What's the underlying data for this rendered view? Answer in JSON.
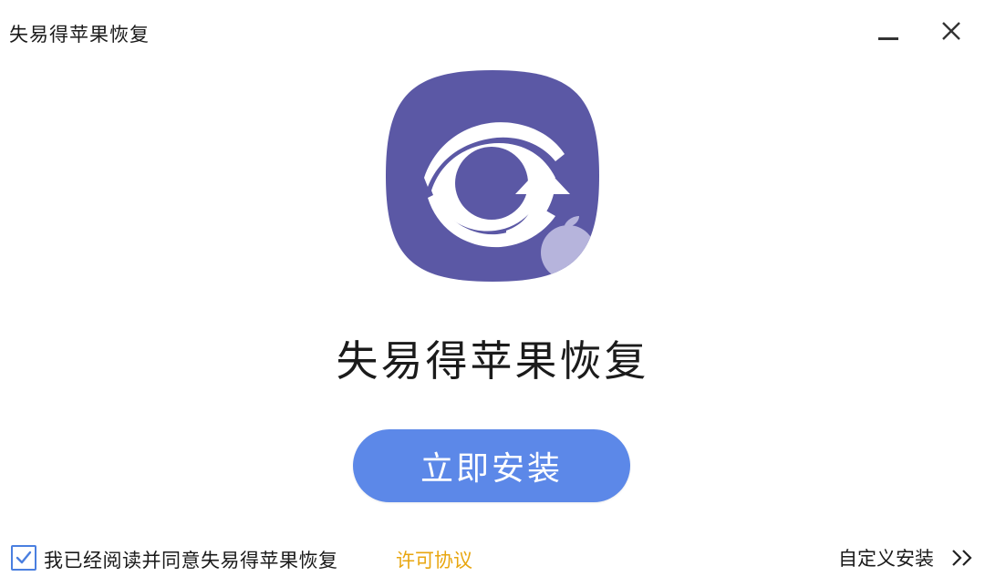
{
  "window": {
    "title": "失易得苹果恢复"
  },
  "app": {
    "name": "失易得苹果恢复",
    "icon": "recovery-eye-arrow-icon",
    "icon_color": "#5b58a5"
  },
  "install_button": {
    "label": "立即安装",
    "color": "#5c88e8"
  },
  "footer": {
    "agree_checked": true,
    "agree_text": "我已经阅读并同意失易得苹果恢复",
    "license_link": "许可协议",
    "license_color": "#e8a60f",
    "custom_install_label": "自定义安装"
  }
}
